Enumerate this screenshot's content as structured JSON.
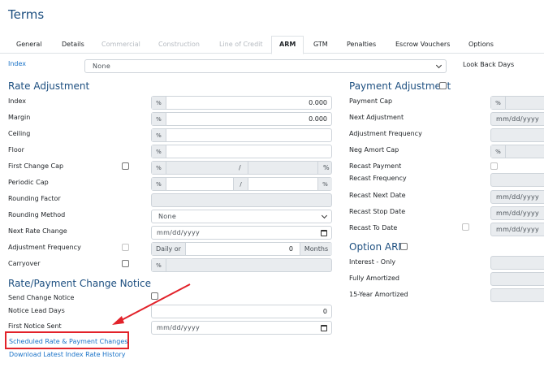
{
  "title": "Terms",
  "tabs": [
    {
      "label": "General",
      "state": "normal"
    },
    {
      "label": "Details",
      "state": "normal"
    },
    {
      "label": "Commercial",
      "state": "disabled"
    },
    {
      "label": "Construction",
      "state": "disabled"
    },
    {
      "label": "Line of Credit",
      "state": "disabled"
    },
    {
      "label": "ARM",
      "state": "active"
    },
    {
      "label": "GTM",
      "state": "normal"
    },
    {
      "label": "Penalties",
      "state": "normal"
    },
    {
      "label": "Escrow Vouchers",
      "state": "normal"
    },
    {
      "label": "Options",
      "state": "normal"
    }
  ],
  "index_row": {
    "label": "Index",
    "value": "None",
    "look_back_label": "Look Back Days"
  },
  "rate_adjustment": {
    "heading": "Rate Adjustment",
    "index": {
      "label": "Index",
      "addon": "%",
      "value": "0.000"
    },
    "margin": {
      "label": "Margin",
      "addon": "%",
      "value": "0.000"
    },
    "ceiling": {
      "label": "Ceiling",
      "addon": "%"
    },
    "floor": {
      "label": "Floor",
      "addon": "%"
    },
    "first_change_cap": {
      "label": "First Change Cap",
      "addon": "%",
      "sep": "/",
      "suffix": "%"
    },
    "periodic_cap": {
      "label": "Periodic Cap",
      "addon": "%",
      "sep": "/",
      "suffix": "%"
    },
    "rounding_factor": {
      "label": "Rounding Factor"
    },
    "rounding_method": {
      "label": "Rounding Method",
      "value": "None"
    },
    "next_rate_change": {
      "label": "Next Rate Change",
      "placeholder": "mm/dd/yyyy"
    },
    "adjustment_frequency": {
      "label": "Adjustment Frequency",
      "prefix": "Daily or",
      "value": "0",
      "suffix": "Months"
    },
    "carryover": {
      "label": "Carryover",
      "addon": "%"
    }
  },
  "notice": {
    "heading": "Rate/Payment Change Notice",
    "send_change_notice": {
      "label": "Send Change Notice"
    },
    "notice_lead_days": {
      "label": "Notice Lead Days",
      "value": "0"
    },
    "first_notice_sent": {
      "label": "First Notice Sent",
      "placeholder": "mm/dd/yyyy"
    }
  },
  "links": {
    "scheduled": "Scheduled Rate & Payment Changes",
    "download": "Download Latest Index Rate History"
  },
  "payment_adjustment": {
    "heading": "Payment Adjustment",
    "payment_cap": {
      "label": "Payment Cap",
      "addon": "%"
    },
    "next_adjustment": {
      "label": "Next Adjustment",
      "placeholder": "mm/dd/yyyy"
    },
    "adjustment_frequency": {
      "label": "Adjustment Frequency"
    },
    "neg_amort_cap": {
      "label": "Neg Amort Cap",
      "addon": "%"
    },
    "recast_payment": {
      "label": "Recast Payment"
    },
    "recast_frequency": {
      "label": "Recast Frequency"
    },
    "recast_next_date": {
      "label": "Recast Next Date",
      "placeholder": "mm/dd/yyyy"
    },
    "recast_stop_date": {
      "label": "Recast Stop Date",
      "placeholder": "mm/dd/yyyy"
    },
    "recast_to_date": {
      "label": "Recast To Date",
      "placeholder": "mm/dd/yyyy"
    }
  },
  "option_arm": {
    "heading": "Option ARM",
    "interest_only": {
      "label": "Interest - Only"
    },
    "fully_amortized": {
      "label": "Fully Amortized"
    },
    "fifteen_year": {
      "label": "15-Year Amortized"
    }
  },
  "colors": {
    "heading": "#1d4f80",
    "link": "#1a73c8",
    "annotation": "#e2222a"
  }
}
